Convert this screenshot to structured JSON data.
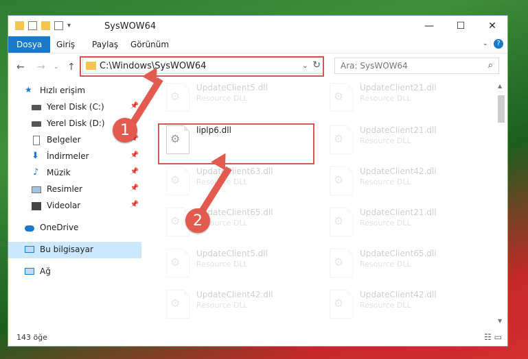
{
  "window": {
    "title": "SysWOW64",
    "minimize_glyph": "—",
    "maximize_glyph": "☐",
    "close_glyph": "✕"
  },
  "ribbon": {
    "tabs": [
      {
        "label": "Dosya"
      },
      {
        "label": "Giriş"
      },
      {
        "label": "Paylaş"
      },
      {
        "label": "Görünüm"
      }
    ],
    "help_glyph": "?"
  },
  "navigation": {
    "back_glyph": "←",
    "forward_glyph": "→",
    "up_glyph": "↑",
    "address": "C:\\Windows\\SysWOW64",
    "search_placeholder": "Ara: SysWOW64"
  },
  "sidebar": {
    "items": [
      {
        "label": "Hızlı erişim",
        "icon": "star-icon"
      },
      {
        "label": "Yerel Disk (C:)",
        "icon": "drive-icon",
        "pinned": true
      },
      {
        "label": "Yerel Disk (D:)",
        "icon": "drive-icon",
        "pinned": true
      },
      {
        "label": "Belgeler",
        "icon": "document-icon",
        "pinned": true
      },
      {
        "label": "İndirmeler",
        "icon": "download-icon",
        "pinned": true
      },
      {
        "label": "Müzik",
        "icon": "music-icon",
        "pinned": true
      },
      {
        "label": "Resimler",
        "icon": "pictures-icon",
        "pinned": true
      },
      {
        "label": "Videolar",
        "icon": "videos-icon",
        "pinned": true
      },
      {
        "label": "OneDrive",
        "icon": "cloud-icon"
      },
      {
        "label": "Bu bilgisayar",
        "icon": "computer-icon",
        "selected": true
      },
      {
        "label": "Ağ",
        "icon": "network-icon"
      }
    ]
  },
  "files": [
    {
      "name": "UpdateClient5.dll",
      "desc": "Resource DLL",
      "faded": true
    },
    {
      "name": "UpdateClient21.dll",
      "desc": "Resource DLL",
      "faded": true
    },
    {
      "name": "liplp6.dll",
      "desc": "",
      "faded": false
    },
    {
      "name": "UpdateClient21.dll",
      "desc": "Resource DLL",
      "faded": true
    },
    {
      "name": "UpdateClient63.dll",
      "desc": "Resource DLL",
      "faded": true
    },
    {
      "name": "UpdateClient42.dll",
      "desc": "Resource DLL",
      "faded": true
    },
    {
      "name": "UpdateClient65.dll",
      "desc": "Resource DLL",
      "faded": true
    },
    {
      "name": "UpdateClient21.dll",
      "desc": "Resource DLL",
      "faded": true
    },
    {
      "name": "UpdateClient5.dll",
      "desc": "Resource DLL",
      "faded": true
    },
    {
      "name": "UpdateClient65.dll",
      "desc": "Resource DLL",
      "faded": true
    },
    {
      "name": "UpdateClient42.dll",
      "desc": "Resource DLL",
      "faded": true
    },
    {
      "name": "UpdateClient42.dll",
      "desc": "Resource DLL",
      "faded": true
    }
  ],
  "status": {
    "count": "143 öğe"
  },
  "annotations": {
    "step1": "1",
    "step2": "2"
  },
  "colors": {
    "accent": "#1979ca",
    "highlight": "#d9534f",
    "badge": "#e35a4f"
  }
}
